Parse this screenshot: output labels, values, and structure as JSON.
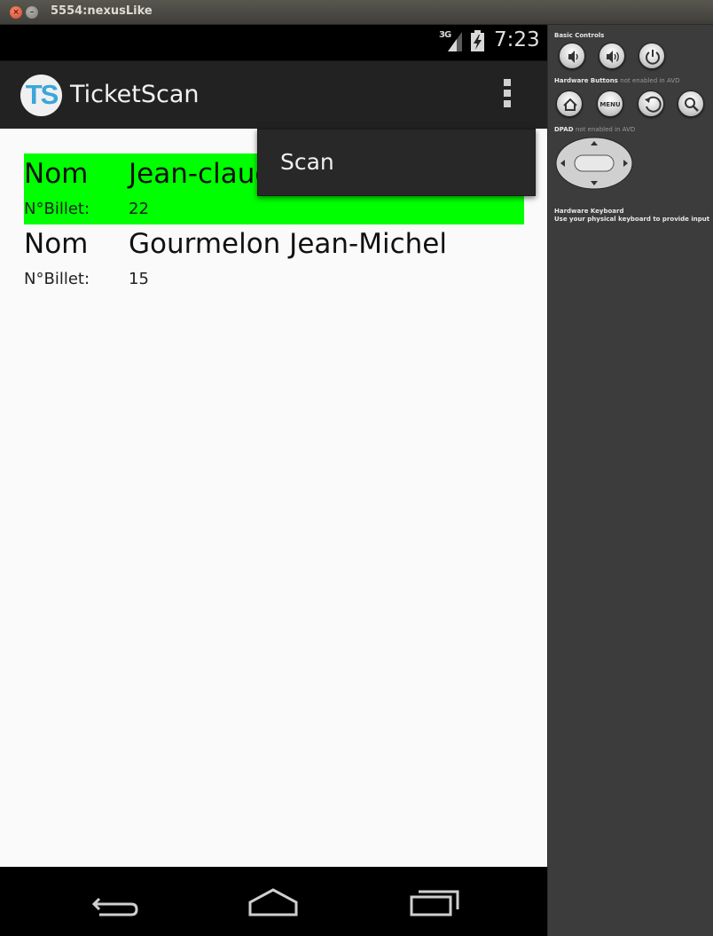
{
  "window": {
    "title": "5554:nexusLike",
    "close_glyph": "×",
    "min_glyph": "–"
  },
  "statusbar": {
    "network": "3G",
    "time": "7:23"
  },
  "actionbar": {
    "logo_text": "TS",
    "app_title": "TicketScan"
  },
  "overflow_menu": {
    "items": [
      {
        "label": "Scan"
      }
    ]
  },
  "tickets": [
    {
      "name_label": "Nom",
      "name": "Jean-claude",
      "ticket_label": "N°Billet:",
      "ticket_no": "22",
      "highlight_color": "#00ff00"
    },
    {
      "name_label": "Nom",
      "name": "Gourmelon Jean-Michel",
      "ticket_label": "N°Billet:",
      "ticket_no": "15"
    }
  ],
  "navbar": {
    "icons": [
      "back-icon",
      "home-icon",
      "recents-icon"
    ]
  },
  "emulator_panel": {
    "basic_controls_title": "Basic Controls",
    "hardware_buttons_title": "Hardware Buttons",
    "hardware_buttons_note": "not enabled in AVD",
    "menu_label": "MENU",
    "dpad_title": "DPAD",
    "dpad_note": "not enabled in AVD",
    "keyboard_title": "Hardware Keyboard",
    "keyboard_note": "Use your physical keyboard to provide input"
  }
}
